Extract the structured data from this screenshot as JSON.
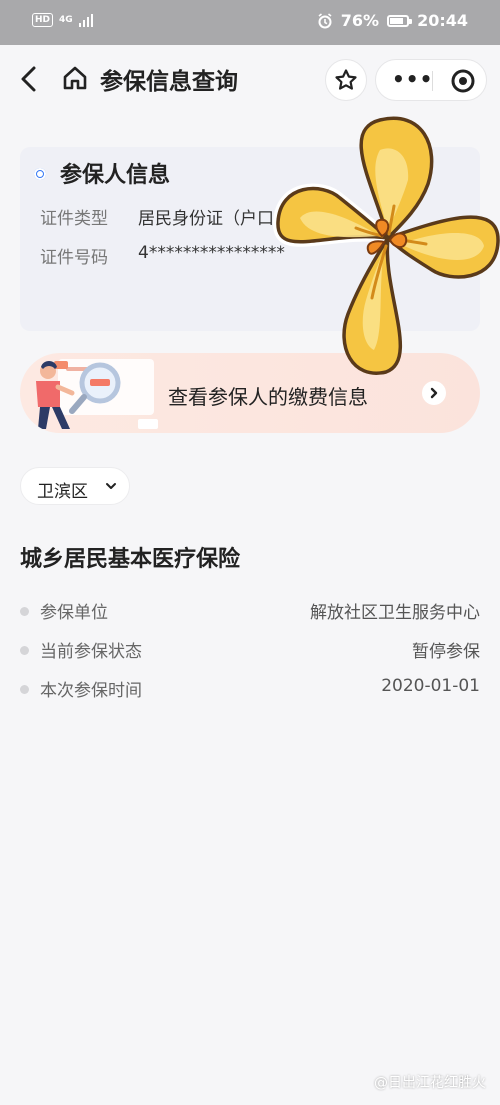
{
  "status_bar": {
    "network": "4G",
    "battery": "76%",
    "time": "20:44"
  },
  "nav": {
    "title": "参保信息查询",
    "more": "•••"
  },
  "insured_card": {
    "title": "参保人信息",
    "rows": [
      {
        "label": "证件类型",
        "value": "居民身份证（户口"
      },
      {
        "label": "证件号码",
        "value": "4****************"
      }
    ]
  },
  "banner": {
    "text": "查看参保人的缴费信息"
  },
  "district": {
    "value": "卫滨区"
  },
  "section": {
    "title": "城乡居民基本医疗保险",
    "rows": [
      {
        "label": "参保单位",
        "value": "解放社区卫生服务中心"
      },
      {
        "label": "当前参保状态",
        "value": "暂停参保"
      },
      {
        "label": "本次参保时间",
        "value": "2020-01-01"
      }
    ]
  },
  "watermark": "@日出江花红胜火",
  "icons": {
    "back": "chevron-left-icon",
    "home": "home-icon",
    "favorite": "star-icon",
    "more": "more-dots-icon",
    "close": "target-icon",
    "expand": "chevron-down-icon",
    "go": "chevron-right-icon"
  },
  "colors": {
    "accent": "#3478f6",
    "status_bar": "#a9a9ab",
    "banner": "#fde9e2",
    "sticker": "#f5c542"
  }
}
